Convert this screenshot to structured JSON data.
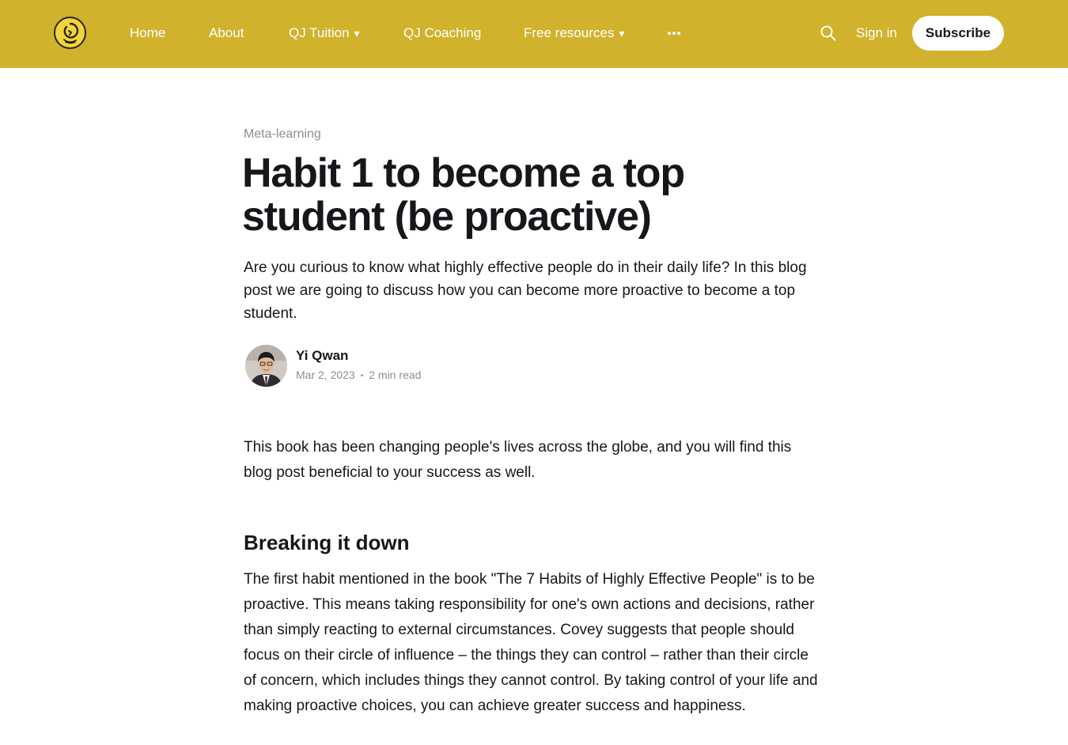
{
  "header": {
    "nav": [
      {
        "label": "Home"
      },
      {
        "label": "About"
      },
      {
        "label": "QJ Tuition",
        "caret": "▾"
      },
      {
        "label": "QJ Coaching"
      },
      {
        "label": "Free resources",
        "caret": "▾"
      }
    ],
    "more_icon": "ellipsis-icon",
    "search_icon": "search-icon",
    "signin_label": "Sign in",
    "subscribe_label": "Subscribe",
    "colors": {
      "bar": "#d0b22d",
      "logo_fill": "#f3d53a"
    }
  },
  "article": {
    "tag": "Meta-learning",
    "title": "Habit 1 to become a top student (be proactive)",
    "excerpt": "Are you curious to know what highly effective people do in their daily life? In this blog post we are going to discuss how you can become more proactive to become a top student.",
    "author": {
      "name": "Yi Qwan",
      "date": "Mar 2, 2023",
      "read_time": "2 min read"
    },
    "body": {
      "intro": "This book has been changing people's lives across the globe, and you will find this blog post beneficial to your success as well.",
      "heading": "Breaking it down",
      "paragraph": "The first habit mentioned in the book \"The 7 Habits of Highly Effective People\" is to be proactive. This means taking responsibility for one's own actions and decisions, rather than simply reacting to external circumstances. Covey suggests that people should focus on their circle of influence – the things they can control – rather than their circle of concern, which includes things they cannot control. By taking control of your life and making proactive choices, you can achieve greater success and happiness."
    }
  }
}
